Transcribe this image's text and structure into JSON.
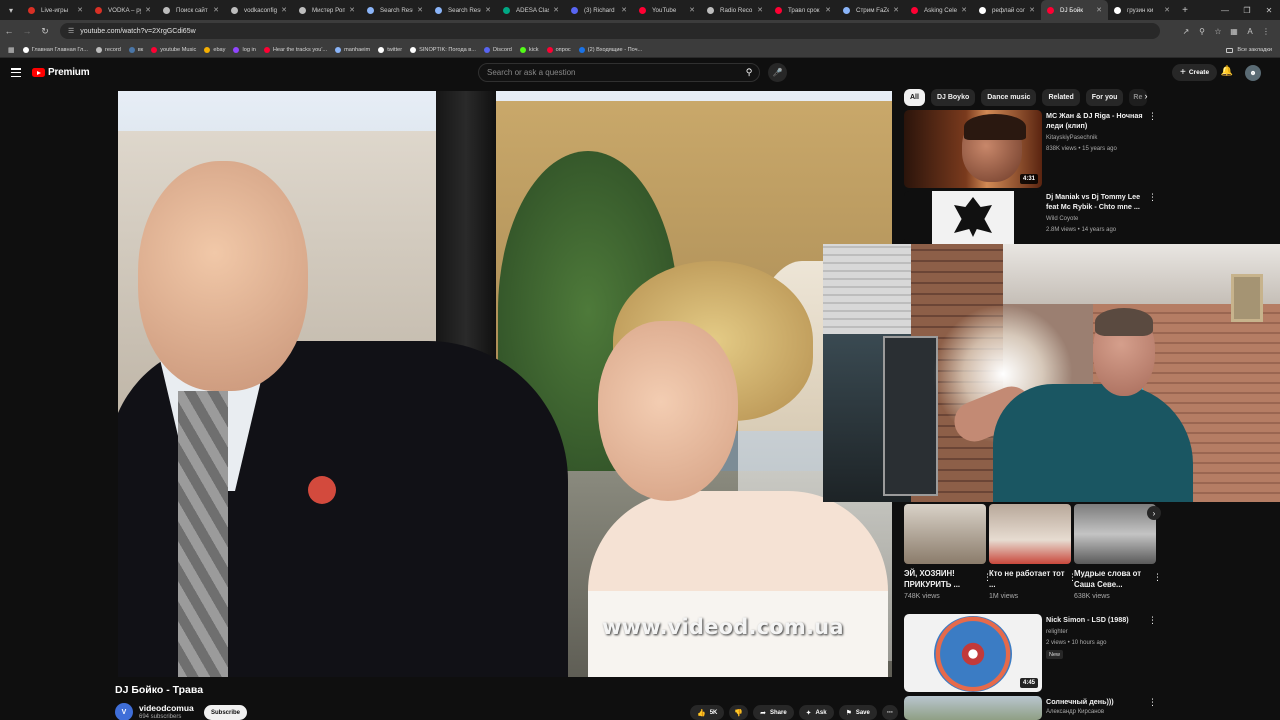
{
  "browser": {
    "tabs": [
      {
        "label": "Live-игры",
        "color": "#d93025",
        "width": 67
      },
      {
        "label": "VODKA – ру",
        "color": "#d93025",
        "width": 68
      },
      {
        "label": "Поиск сайт",
        "color": "#bdbdbd",
        "width": 68
      },
      {
        "label": "vodkaconfig",
        "color": "#bdbdbd",
        "width": 68
      },
      {
        "label": "Мистер Роп",
        "color": "#bdbdbd",
        "width": 68
      },
      {
        "label": "Search Resu",
        "color": "#8ab4f8",
        "width": 68
      },
      {
        "label": "Search Resu",
        "color": "#8ab4f8",
        "width": 68
      },
      {
        "label": "ADESA Class",
        "color": "#00a884",
        "width": 68
      },
      {
        "label": "(3) Richard",
        "color": "#5865f2",
        "width": 68
      },
      {
        "label": "YouTube",
        "color": "#ff0033",
        "width": 68
      },
      {
        "label": "Radio Reco",
        "color": "#bdbdbd",
        "width": 68
      },
      {
        "label": "Травл срок",
        "color": "#ff0033",
        "width": 68
      },
      {
        "label": "Стрим FaZe",
        "color": "#8ab4f8",
        "width": 68
      },
      {
        "label": "Asking Cele",
        "color": "#ff0033",
        "width": 68
      },
      {
        "label": "рефлай сол",
        "color": "#ffffff",
        "width": 68
      },
      {
        "label": "DJ Бойк",
        "color": "#ff0033",
        "width": 67
      },
      {
        "label": "грузин ки",
        "color": "#ffffff",
        "width": 68
      }
    ],
    "active_tab_index": 15,
    "url": "youtube.com/watch?v=2XrgGCdi65w",
    "bookmarks": [
      {
        "label": "Главная Главная Гл...",
        "color": "#ffffff"
      },
      {
        "label": "record",
        "color": "#bdbdbd"
      },
      {
        "label": "вк",
        "color": "#4a76a8"
      },
      {
        "label": "youtube Music",
        "color": "#ff0033"
      },
      {
        "label": "ebay",
        "color": "#f5af02"
      },
      {
        "label": "log in",
        "color": "#9146ff"
      },
      {
        "label": "Hear the tracks you'...",
        "color": "#ff0033"
      },
      {
        "label": "manhaeim",
        "color": "#8ab4f8"
      },
      {
        "label": "twitter",
        "color": "#ffffff"
      },
      {
        "label": "SINOPTIK: Погода в...",
        "color": "#ffffff"
      },
      {
        "label": "Discord",
        "color": "#5865f2"
      },
      {
        "label": "kick",
        "color": "#53fc18"
      },
      {
        "label": "опрос",
        "color": "#ff0033"
      },
      {
        "label": "(2) Входящие - Поч...",
        "color": "#1a73e8"
      }
    ],
    "all_bookmarks_label": "Все закладки"
  },
  "masthead": {
    "logo_text": "Premium",
    "search_placeholder": "Search or ask a question",
    "create_label": "Create"
  },
  "video": {
    "watermark": "www.videod.com.ua",
    "title": "DJ Бойко - Трава",
    "channel_name": "videodcomua",
    "channel_initial": "V",
    "channel_subs": "694 subscribers",
    "subscribe_label": "Subscribe",
    "like_count": "5K",
    "share_label": "Share",
    "ask_label": "Ask",
    "save_label": "Save"
  },
  "sidebar": {
    "chips": [
      "All",
      "DJ Boyko",
      "Dance music",
      "Related",
      "For you",
      "Re"
    ],
    "recommendations": [
      {
        "title": "МС Жан & DJ Riga - Ночная леди (клип)",
        "channel": "KitayskiyPasechnik",
        "meta": "838K views • 15 years ago",
        "duration": "4:31"
      },
      {
        "title": "Dj Maniak vs Dj Tommy Lee feat Mc Rybik - Chto mne ...",
        "channel": "Wild Coyote",
        "meta": "2.8M views • 14 years ago",
        "duration": ""
      }
    ],
    "shorts": [
      {
        "title": "ЭЙ, ХОЗЯИН! ПРИКУРИТЬ ...",
        "views": "748K views"
      },
      {
        "title": "Кто не работает тот ...",
        "views": "1M views"
      },
      {
        "title": "Мудрые слова от Саша Севе...",
        "views": "638K views"
      }
    ],
    "recommendations_lower": [
      {
        "title": "Nick Simon - LSD (1988)",
        "channel": "relighter",
        "meta": "2 views • 10 hours ago",
        "badge": "New",
        "duration": "4:45"
      },
      {
        "title": "Солнечный день)))",
        "channel": "Александр Кирсанов",
        "meta": "",
        "badge": "",
        "duration": ""
      }
    ]
  }
}
